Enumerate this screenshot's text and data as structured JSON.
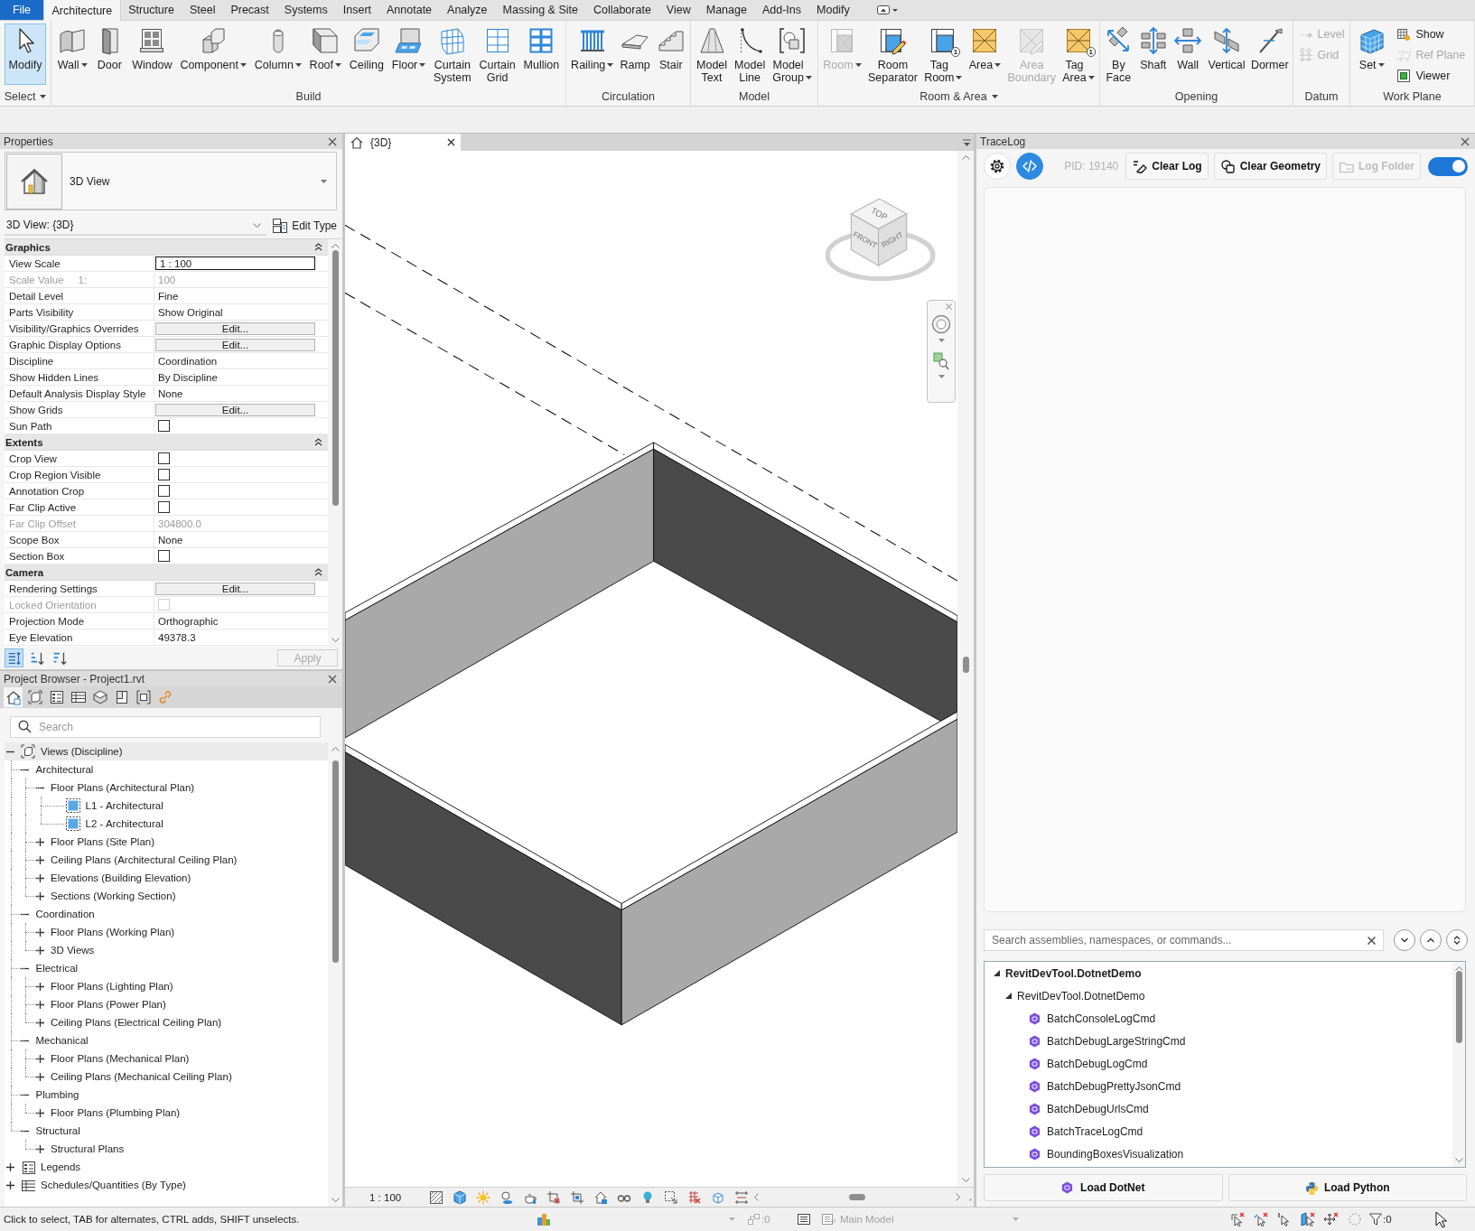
{
  "ribbon": {
    "file_tab": {
      "label": "File"
    },
    "tabs": [
      {
        "label": "Architecture",
        "selected": true
      },
      {
        "label": "Structure",
        "selected": false
      },
      {
        "label": "Steel",
        "selected": false
      },
      {
        "label": "Precast",
        "selected": false
      },
      {
        "label": "Systems",
        "selected": false
      },
      {
        "label": "Insert",
        "selected": false
      },
      {
        "label": "Annotate",
        "selected": false
      },
      {
        "label": "Analyze",
        "selected": false
      },
      {
        "label": "Massing & Site",
        "selected": false
      },
      {
        "label": "Collaborate",
        "selected": false
      },
      {
        "label": "View",
        "selected": false
      },
      {
        "label": "Manage",
        "selected": false
      },
      {
        "label": "Add-Ins",
        "selected": false
      },
      {
        "label": "Modify",
        "selected": false
      }
    ],
    "panels": [
      {
        "title": "Select",
        "dropdown": true,
        "buttons": [
          {
            "label": "Modify",
            "selected": true,
            "disabled": false,
            "dropdown": false
          }
        ]
      },
      {
        "title": "Build",
        "dropdown": false,
        "buttons": [
          {
            "label": "Wall",
            "disabled": false,
            "dropdown": true
          },
          {
            "label": "Door",
            "disabled": false,
            "dropdown": false
          },
          {
            "label": "Window",
            "disabled": false,
            "dropdown": false
          },
          {
            "label": "Component",
            "disabled": false,
            "dropdown": true
          },
          {
            "label": "Column",
            "disabled": false,
            "dropdown": true
          },
          {
            "label": "Roof",
            "disabled": false,
            "dropdown": true
          },
          {
            "label": "Ceiling",
            "disabled": false,
            "dropdown": false
          },
          {
            "label": "Floor",
            "disabled": false,
            "dropdown": true
          },
          {
            "label": "Curtain System",
            "disabled": false,
            "dropdown": false
          },
          {
            "label": "Curtain Grid",
            "disabled": false,
            "dropdown": false
          },
          {
            "label": "Mullion",
            "disabled": false,
            "dropdown": false
          }
        ]
      },
      {
        "title": "Circulation",
        "dropdown": false,
        "buttons": [
          {
            "label": "Railing",
            "disabled": false,
            "dropdown": true
          },
          {
            "label": "Ramp",
            "disabled": false,
            "dropdown": false
          },
          {
            "label": "Stair",
            "disabled": false,
            "dropdown": false
          }
        ]
      },
      {
        "title": "Model",
        "dropdown": false,
        "buttons": [
          {
            "label": "Model Text",
            "disabled": false,
            "dropdown": false
          },
          {
            "label": "Model Line",
            "disabled": false,
            "dropdown": false
          },
          {
            "label": "Model Group",
            "disabled": false,
            "dropdown": true
          }
        ]
      },
      {
        "title": "Room & Area",
        "dropdown": true,
        "buttons": [
          {
            "label": "Room",
            "disabled": true,
            "dropdown": true
          },
          {
            "label": "Room Separator",
            "disabled": false,
            "dropdown": false
          },
          {
            "label": "Tag Room",
            "disabled": false,
            "dropdown": true,
            "badge": "1"
          },
          {
            "label": "Area",
            "disabled": false,
            "dropdown": true
          },
          {
            "label": "Area Boundary",
            "disabled": true,
            "dropdown": false
          },
          {
            "label": "Tag Area",
            "disabled": false,
            "dropdown": true,
            "badge": "1"
          }
        ]
      },
      {
        "title": "Opening",
        "dropdown": false,
        "buttons": [
          {
            "label": "By Face",
            "disabled": false,
            "dropdown": false
          },
          {
            "label": "Shaft",
            "disabled": false,
            "dropdown": false
          },
          {
            "label": "Wall",
            "disabled": false,
            "dropdown": false
          },
          {
            "label": "Vertical",
            "disabled": false,
            "dropdown": false
          },
          {
            "label": "Dormer",
            "disabled": false,
            "dropdown": false
          }
        ]
      },
      {
        "title": "Datum",
        "dropdown": false,
        "buttons": [
          {
            "label": "Level",
            "kind": "small",
            "disabled": true,
            "dropdown": false
          },
          {
            "label": "Grid",
            "kind": "small",
            "disabled": true,
            "dropdown": false
          }
        ]
      },
      {
        "title": "Work Plane",
        "dropdown": false,
        "buttons": [
          {
            "label": "Set",
            "kind": "large",
            "disabled": false,
            "dropdown": true
          },
          {
            "label": "Show",
            "kind": "small",
            "disabled": false,
            "dropdown": false
          },
          {
            "label": "Ref Plane",
            "kind": "small",
            "disabled": true,
            "dropdown": false
          },
          {
            "label": "Viewer",
            "kind": "small",
            "disabled": false,
            "dropdown": false
          }
        ]
      }
    ]
  },
  "properties": {
    "title": "Properties",
    "type_name": "3D View",
    "instance": "3D View: {3D}",
    "edit_type": "Edit Type",
    "groups": [
      {
        "title": "Graphics",
        "expanded": true,
        "rows": [
          {
            "label": "View Scale",
            "kind": "field",
            "value": "1 : 100",
            "disabled": false
          },
          {
            "label": "Scale Value",
            "unit": "1:",
            "kind": "text",
            "value": "100",
            "disabled": true
          },
          {
            "label": "Detail Level",
            "kind": "text",
            "value": "Fine",
            "disabled": false
          },
          {
            "label": "Parts Visibility",
            "kind": "text",
            "value": "Show Original",
            "disabled": false
          },
          {
            "label": "Visibility/Graphics Overrides",
            "kind": "button",
            "value": "Edit...",
            "disabled": false
          },
          {
            "label": "Graphic Display Options",
            "kind": "button",
            "value": "Edit...",
            "disabled": false
          },
          {
            "label": "Discipline",
            "kind": "text",
            "value": "Coordination",
            "disabled": false
          },
          {
            "label": "Show Hidden Lines",
            "kind": "text",
            "value": "By Discipline",
            "disabled": false
          },
          {
            "label": "Default Analysis Display Style",
            "kind": "text",
            "value": "None",
            "disabled": false
          },
          {
            "label": "Show Grids",
            "kind": "button",
            "value": "Edit...",
            "disabled": false
          },
          {
            "label": "Sun Path",
            "kind": "checkbox",
            "checked": false,
            "disabled": false
          }
        ]
      },
      {
        "title": "Extents",
        "expanded": true,
        "rows": [
          {
            "label": "Crop View",
            "kind": "checkbox",
            "checked": false,
            "disabled": false
          },
          {
            "label": "Crop Region Visible",
            "kind": "checkbox",
            "checked": false,
            "disabled": false
          },
          {
            "label": "Annotation Crop",
            "kind": "checkbox",
            "checked": false,
            "disabled": false
          },
          {
            "label": "Far Clip Active",
            "kind": "checkbox",
            "checked": false,
            "disabled": false
          },
          {
            "label": "Far Clip Offset",
            "kind": "text",
            "value": "304800.0",
            "disabled": true
          },
          {
            "label": "Scope Box",
            "kind": "text",
            "value": "None",
            "disabled": false
          },
          {
            "label": "Section Box",
            "kind": "checkbox",
            "checked": false,
            "disabled": false
          }
        ]
      },
      {
        "title": "Camera",
        "expanded": true,
        "rows": [
          {
            "label": "Rendering Settings",
            "kind": "button",
            "value": "Edit...",
            "disabled": false
          },
          {
            "label": "Locked Orientation",
            "kind": "checkbox",
            "checked": false,
            "disabled": true
          },
          {
            "label": "Projection Mode",
            "kind": "text",
            "value": "Orthographic",
            "disabled": false
          },
          {
            "label": "Eye Elevation",
            "kind": "text",
            "value": "49378.3",
            "disabled": false
          }
        ]
      }
    ],
    "sort_buttons": [
      {
        "selected": true
      },
      {
        "selected": false
      },
      {
        "selected": false
      }
    ],
    "apply": {
      "label": "Apply",
      "disabled": true
    }
  },
  "project_browser": {
    "title": "Project Browser - Project1.rvt",
    "tools": [
      {
        "selected": true
      },
      {
        "selected": false
      },
      {
        "selected": false
      },
      {
        "selected": false
      },
      {
        "selected": false
      },
      {
        "selected": false
      },
      {
        "selected": false
      },
      {
        "selected": false
      }
    ],
    "search": {
      "placeholder": "Search"
    },
    "tree": [
      {
        "label": "Views (Discipline)",
        "expanded": true,
        "children": [
          {
            "label": "Architectural",
            "expanded": true,
            "children": [
              {
                "label": "Floor Plans (Architectural Plan)",
                "expanded": true,
                "children": [
                  {
                    "label": "L1 - Architectural"
                  },
                  {
                    "label": "L2 - Architectural"
                  }
                ]
              },
              {
                "label": "Floor Plans (Site Plan)",
                "expanded": false
              },
              {
                "label": "Ceiling Plans (Architectural Ceiling Plan)",
                "expanded": false
              },
              {
                "label": "Elevations (Building Elevation)",
                "expanded": false
              },
              {
                "label": "Sections (Working Section)",
                "expanded": false
              }
            ]
          },
          {
            "label": "Coordination",
            "expanded": true,
            "children": [
              {
                "label": "Floor Plans (Working Plan)",
                "expanded": false
              },
              {
                "label": "3D Views",
                "expanded": false
              }
            ]
          },
          {
            "label": "Electrical",
            "expanded": true,
            "children": [
              {
                "label": "Floor Plans (Lighting Plan)",
                "expanded": false
              },
              {
                "label": "Floor Plans (Power Plan)",
                "expanded": false
              },
              {
                "label": "Ceiling Plans (Electrical Ceiling Plan)",
                "expanded": false
              }
            ]
          },
          {
            "label": "Mechanical",
            "expanded": true,
            "children": [
              {
                "label": "Floor Plans (Mechanical Plan)",
                "expanded": false
              },
              {
                "label": "Ceiling Plans (Mechanical Ceiling Plan)",
                "expanded": false
              }
            ]
          },
          {
            "label": "Plumbing",
            "expanded": true,
            "children": [
              {
                "label": "Floor Plans (Plumbing Plan)",
                "expanded": false
              }
            ]
          },
          {
            "label": "Structural",
            "expanded": true,
            "children": [
              {
                "label": "Structural Plans",
                "expanded": false
              }
            ]
          }
        ]
      },
      {
        "label": "Legends",
        "expanded": false
      },
      {
        "label": "Schedules/Quantities (By Type)",
        "expanded": false
      }
    ]
  },
  "view": {
    "tab": {
      "title": "{3D}"
    },
    "view_cube": {
      "top": "TOP",
      "front": "FRONT",
      "right": "RIGHT"
    },
    "scale": "1 : 100"
  },
  "tracelog": {
    "title": "TraceLog",
    "icon_buttons": [
      {
        "selected": false
      },
      {
        "selected": true
      }
    ],
    "pid": "PID: 19140",
    "actions": [
      {
        "label": "Clear Log",
        "disabled": false
      },
      {
        "label": "Clear Geometry",
        "disabled": false
      },
      {
        "label": "Log Folder",
        "disabled": true
      }
    ],
    "toggle": {
      "on": true
    },
    "search": {
      "placeholder": "Search assemblies, namespaces, or commands..."
    },
    "tree": [
      {
        "label": "RevitDevTool.DotnetDemo",
        "expanded": true,
        "children": [
          {
            "label": "RevitDevTool.DotnetDemo",
            "expanded": true,
            "children": [
              {
                "label": "BatchConsoleLogCmd"
              },
              {
                "label": "BatchDebugLargeStringCmd"
              },
              {
                "label": "BatchDebugLogCmd"
              },
              {
                "label": "BatchDebugPrettyJsonCmd"
              },
              {
                "label": "BatchDebugUrlsCmd"
              },
              {
                "label": "BatchTraceLogCmd"
              },
              {
                "label": "BoundingBoxesVisualization"
              }
            ]
          }
        ]
      }
    ],
    "load_buttons": [
      {
        "label": "Load DotNet"
      },
      {
        "label": "Load Python"
      }
    ]
  },
  "status_bar": {
    "message": "Click to select, TAB for alternates, CTRL adds, SHIFT unselects.",
    "counter": ":0",
    "model": "Main Model",
    "filter_count": ":0"
  }
}
